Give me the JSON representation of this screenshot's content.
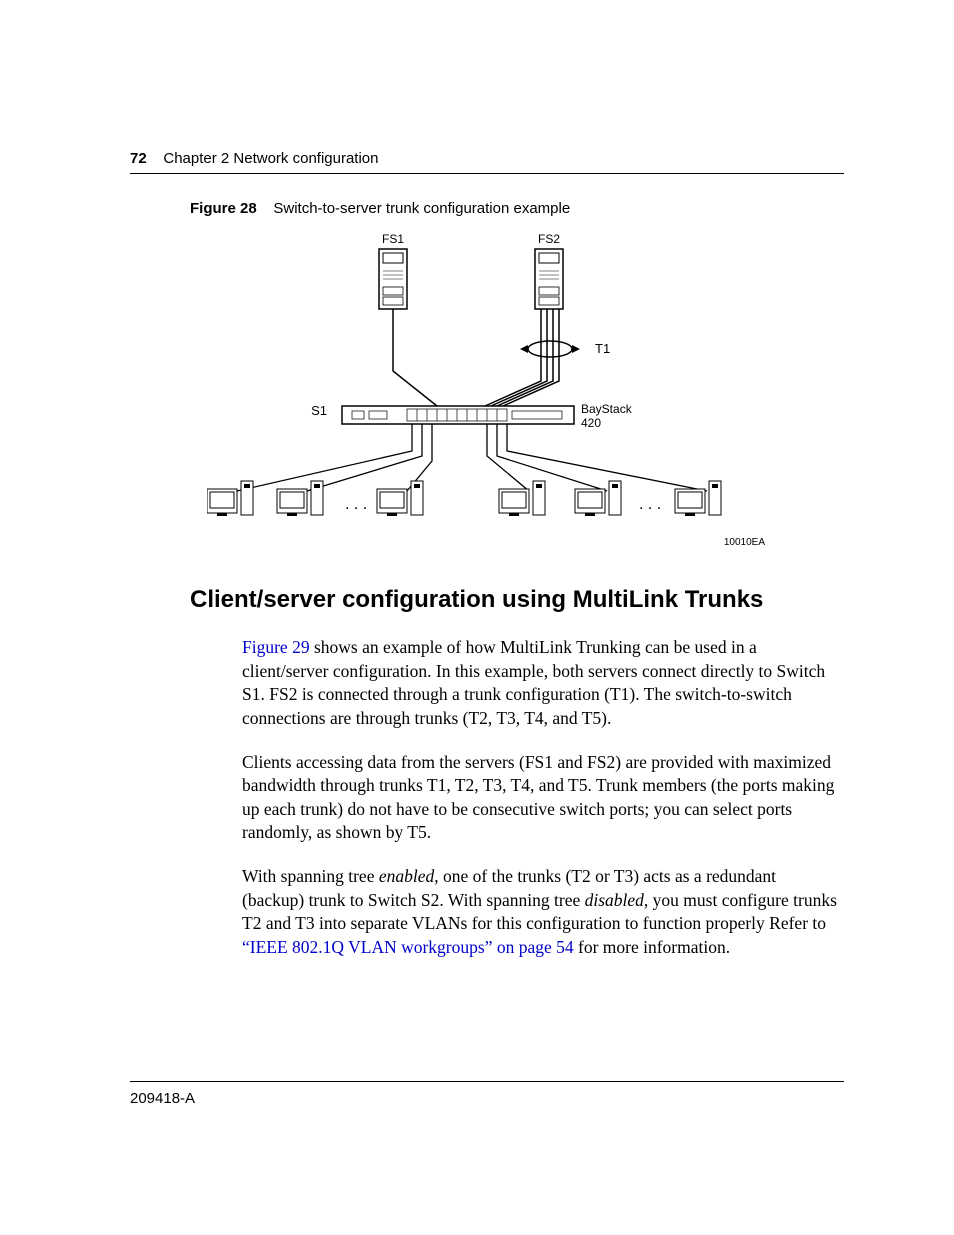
{
  "header": {
    "page_number": "72",
    "chapter_text": "Chapter 2  Network configuration"
  },
  "figure": {
    "label": "Figure 28",
    "title": "Switch-to-server trunk configuration example",
    "labels": {
      "fs1": "FS1",
      "fs2": "FS2",
      "t1": "T1",
      "s1": "S1",
      "switch_model": "BayStack 420",
      "diagram_id": "10010EA"
    }
  },
  "section": {
    "heading": "Client/server configuration using MultiLink Trunks"
  },
  "paragraphs": {
    "p1_link": "Figure 29",
    "p1_rest": " shows an example of how MultiLink Trunking can be used in a client/server configuration. In this example, both servers connect directly to Switch S1. FS2 is connected through a trunk configuration (T1). The switch-to-switch connections are through trunks (T2, T3, T4, and T5).",
    "p2": "Clients accessing data from the servers (FS1 and FS2) are provided with maximized bandwidth through trunks T1, T2, T3, T4, and T5. Trunk members (the ports making up each trunk) do not have to be consecutive switch ports; you can select ports randomly, as shown by T5.",
    "p3_a": "With spanning tree ",
    "p3_enabled": "enabled",
    "p3_b": ", one of the trunks (T2 or T3) acts as a redundant (backup) trunk to Switch S2. With spanning tree ",
    "p3_disabled": "disabled",
    "p3_c": ", you must configure trunks T2 and T3 into separate VLANs for this configuration to function properly Refer to ",
    "p3_link": "“IEEE 802.1Q VLAN workgroups” on page 54",
    "p3_d": " for more information."
  },
  "footer": {
    "doc_number": "209418-A"
  }
}
